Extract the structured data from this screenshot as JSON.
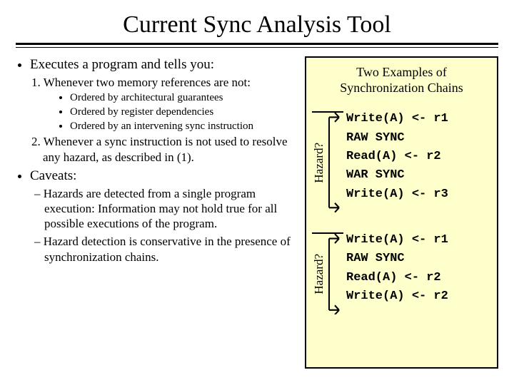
{
  "title": "Current Sync Analysis Tool",
  "left": {
    "bullet1": "Executes a program and tells you:",
    "item1": "1. Whenever two memory references are not:",
    "sub": {
      "a": "Ordered by architectural guarantees",
      "b": "Ordered by register dependencies",
      "c": "Ordered by an intervening sync instruction"
    },
    "item2": "2. Whenever a sync instruction is not used to resolve any hazard, as described in (1).",
    "bullet2": "Caveats:",
    "dash1": "– Hazards are detected from a single program execution:  Information may not hold true for all possible executions of the program.",
    "dash2": "– Hazard detection is conservative in the presence of synchronization chains."
  },
  "panel": {
    "title_l1": "Two Examples of",
    "title_l2": "Synchronization Chains",
    "hazard_label": "Hazard?",
    "ex1": {
      "l1": "Write(A) <- r1",
      "l2": "RAW SYNC",
      "l3": "Read(A) <- r2",
      "l4": "WAR SYNC",
      "l5": "Write(A) <- r3"
    },
    "ex2": {
      "l1": "Write(A) <- r1",
      "l2": "RAW SYNC",
      "l3": "Read(A) <- r2",
      "l4": "Write(A) <- r2"
    }
  }
}
